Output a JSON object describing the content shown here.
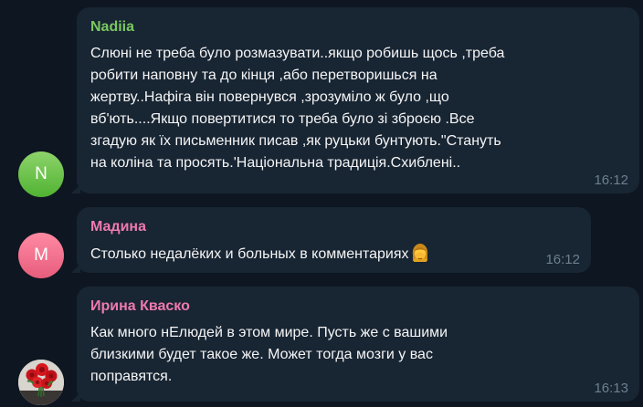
{
  "messages": [
    {
      "sender": "Nadiia",
      "avatar_initial": "N",
      "text": "Слюні не треба було розмазувати..якщо робишь щось ,треба\nробити наповну та до кінця ,або перетворишься на\nжертву..Нафіга він повернувся ,зрозуміло ж було ,що\nвб'ють....Якщо повертитися то треба було зі зброєю .Все\nзгадую як їх письменник писав ,як руцьки бунтують.\"Стануть\nна коліна та  просять.'Національна традиція.Схиблені..",
      "time": "16:12",
      "colors": {
        "name": "#7bc862",
        "avatar": "#5ebe3f"
      }
    },
    {
      "sender": "Мадина",
      "avatar_initial": "M",
      "text": "Столько недалёких и больных в комментариях",
      "emoji": "woman-facepalming-icon",
      "time": "16:12",
      "colors": {
        "name": "#ee7aae",
        "avatar": "#f47a93"
      }
    },
    {
      "sender": "Ирина Кваско",
      "avatar_image": "red-roses-photo",
      "text": "Как много нЕлюдей в этом мире.  Пусть же с вашими\nблизкими будет такое же.  Может тогда мозги у вас\nпоправятся.",
      "time": "16:13",
      "colors": {
        "name": "#ee7aae"
      }
    }
  ],
  "theme": {
    "background": "#0e1621",
    "bubble": "#182533",
    "text": "#f5f5f5",
    "timestamp": "#6d7f8f"
  }
}
